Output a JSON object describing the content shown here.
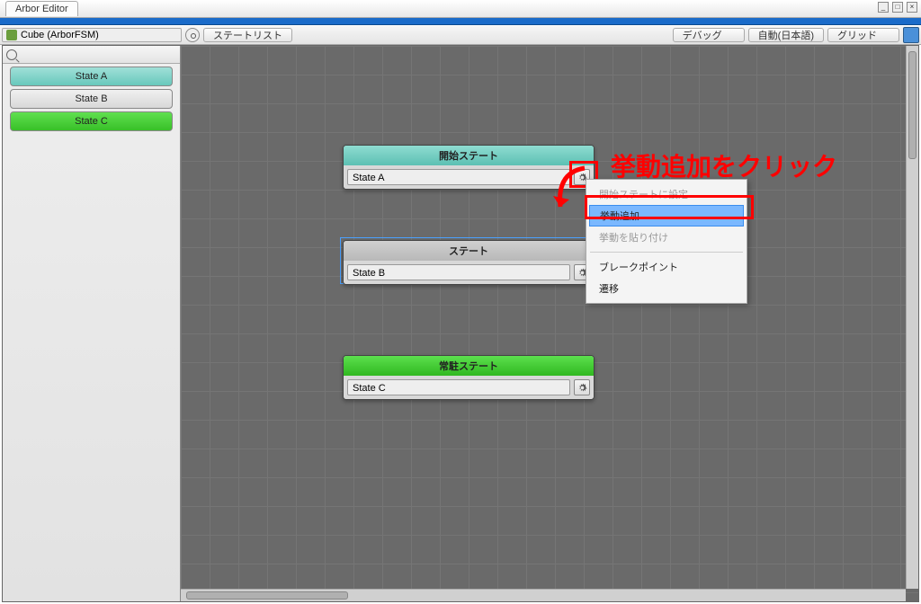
{
  "window": {
    "title": "Arbor Editor"
  },
  "toolbar": {
    "object_name": "Cube (ArborFSM)",
    "state_list_btn": "ステートリスト",
    "debug_label": "デバッグ",
    "lang_label": "自動(日本語)",
    "grid_label": "グリッド"
  },
  "sidebar": {
    "items": [
      {
        "label": "State A",
        "kind": "start"
      },
      {
        "label": "State B",
        "kind": "normal"
      },
      {
        "label": "State C",
        "kind": "resident"
      }
    ]
  },
  "nodes": {
    "a": {
      "header": "開始ステート",
      "name": "State A"
    },
    "b": {
      "header": "ステート",
      "name": "State B"
    },
    "c": {
      "header": "常駐ステート",
      "name": "State C"
    }
  },
  "context_menu": {
    "set_start": "開始ステートに設定",
    "add_behavior": "挙動追加",
    "paste_behavior": "挙動を貼り付け",
    "breakpoint": "ブレークポイント",
    "transition": "遷移"
  },
  "callout": {
    "text": "挙動追加をクリック"
  }
}
